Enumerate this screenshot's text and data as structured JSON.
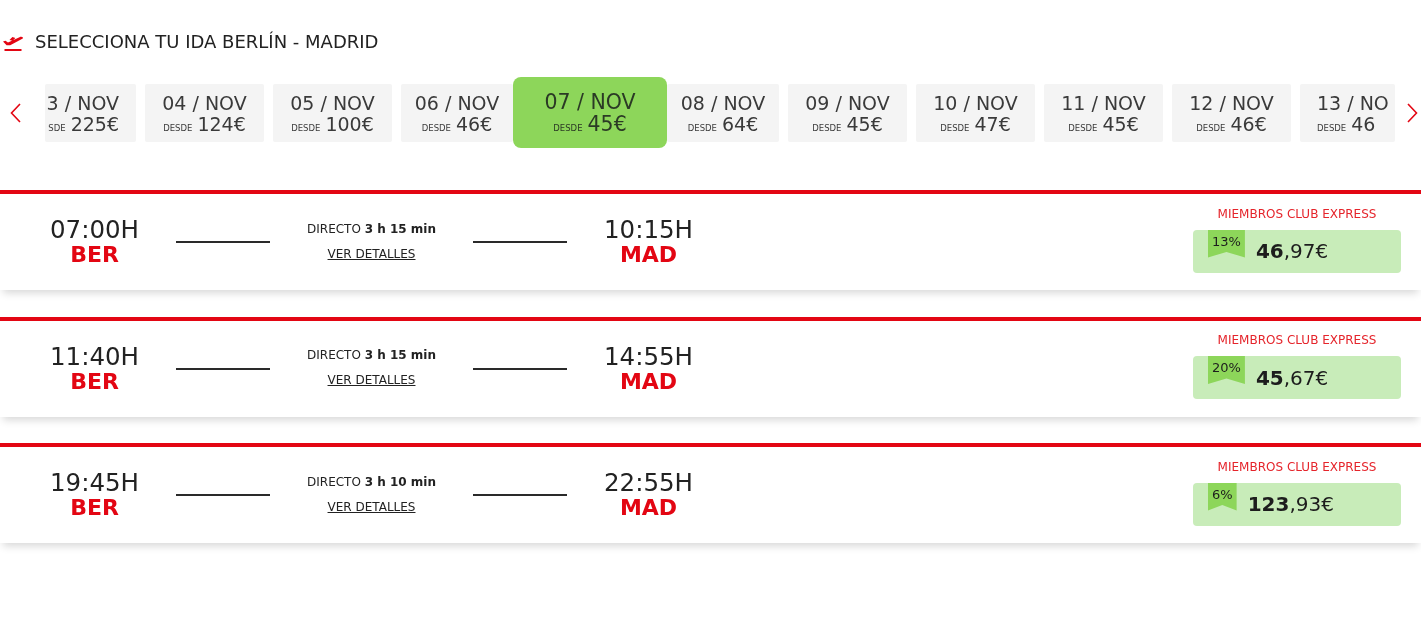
{
  "header": {
    "title": "SELECCIONA TU IDA BERLÍN - MADRID"
  },
  "date_carousel": {
    "dates": [
      {
        "date": "3 / NOV",
        "from_label": "SDE",
        "price": "225€",
        "selected": false
      },
      {
        "date": "04 / NOV",
        "from_label": "DESDE",
        "price": "124€",
        "selected": false
      },
      {
        "date": "05 / NOV",
        "from_label": "DESDE",
        "price": "100€",
        "selected": false
      },
      {
        "date": "06 / NOV",
        "from_label": "DESDE",
        "price": "46€",
        "selected": false
      },
      {
        "date": "07 / NOV",
        "from_label": "DESDE",
        "price": "45€",
        "selected": true
      },
      {
        "date": "08 / NOV",
        "from_label": "DESDE",
        "price": "64€",
        "selected": false
      },
      {
        "date": "09 / NOV",
        "from_label": "DESDE",
        "price": "45€",
        "selected": false
      },
      {
        "date": "10 / NOV",
        "from_label": "DESDE",
        "price": "47€",
        "selected": false
      },
      {
        "date": "11 / NOV",
        "from_label": "DESDE",
        "price": "45€",
        "selected": false
      },
      {
        "date": "12 / NOV",
        "from_label": "DESDE",
        "price": "46€",
        "selected": false
      },
      {
        "date": "13 / NO",
        "from_label": "DESDE",
        "price": "46",
        "selected": false
      }
    ]
  },
  "flights": [
    {
      "departure_time": "07:00H",
      "departure_airport": "BER",
      "route_info": "DIRECTO **3 h 15 min**",
      "details_link": "VER DETALLES",
      "arrival_time": "10:15H",
      "arrival_airport": "MAD",
      "fare_label": "MIEMBROS CLUB EXPRESS",
      "discount": "13%",
      "price": "**46**,97€"
    },
    {
      "departure_time": "11:40H",
      "departure_airport": "BER",
      "route_info": "DIRECTO **3 h 15 min**",
      "details_link": "VER DETALLES",
      "arrival_time": "14:55H",
      "arrival_airport": "MAD",
      "fare_label": "MIEMBROS CLUB EXPRESS",
      "discount": "20%",
      "price": "**45**,67€"
    },
    {
      "departure_time": "19:45H",
      "departure_airport": "BER",
      "route_info": "DIRECTO **3 h 10 min**",
      "details_link": "VER DETALLES",
      "arrival_time": "22:55H",
      "arrival_airport": "MAD",
      "fare_label": "MIEMBROS CLUB EXPRESS",
      "discount": "6%",
      "price": "**123**,93€"
    }
  ]
}
